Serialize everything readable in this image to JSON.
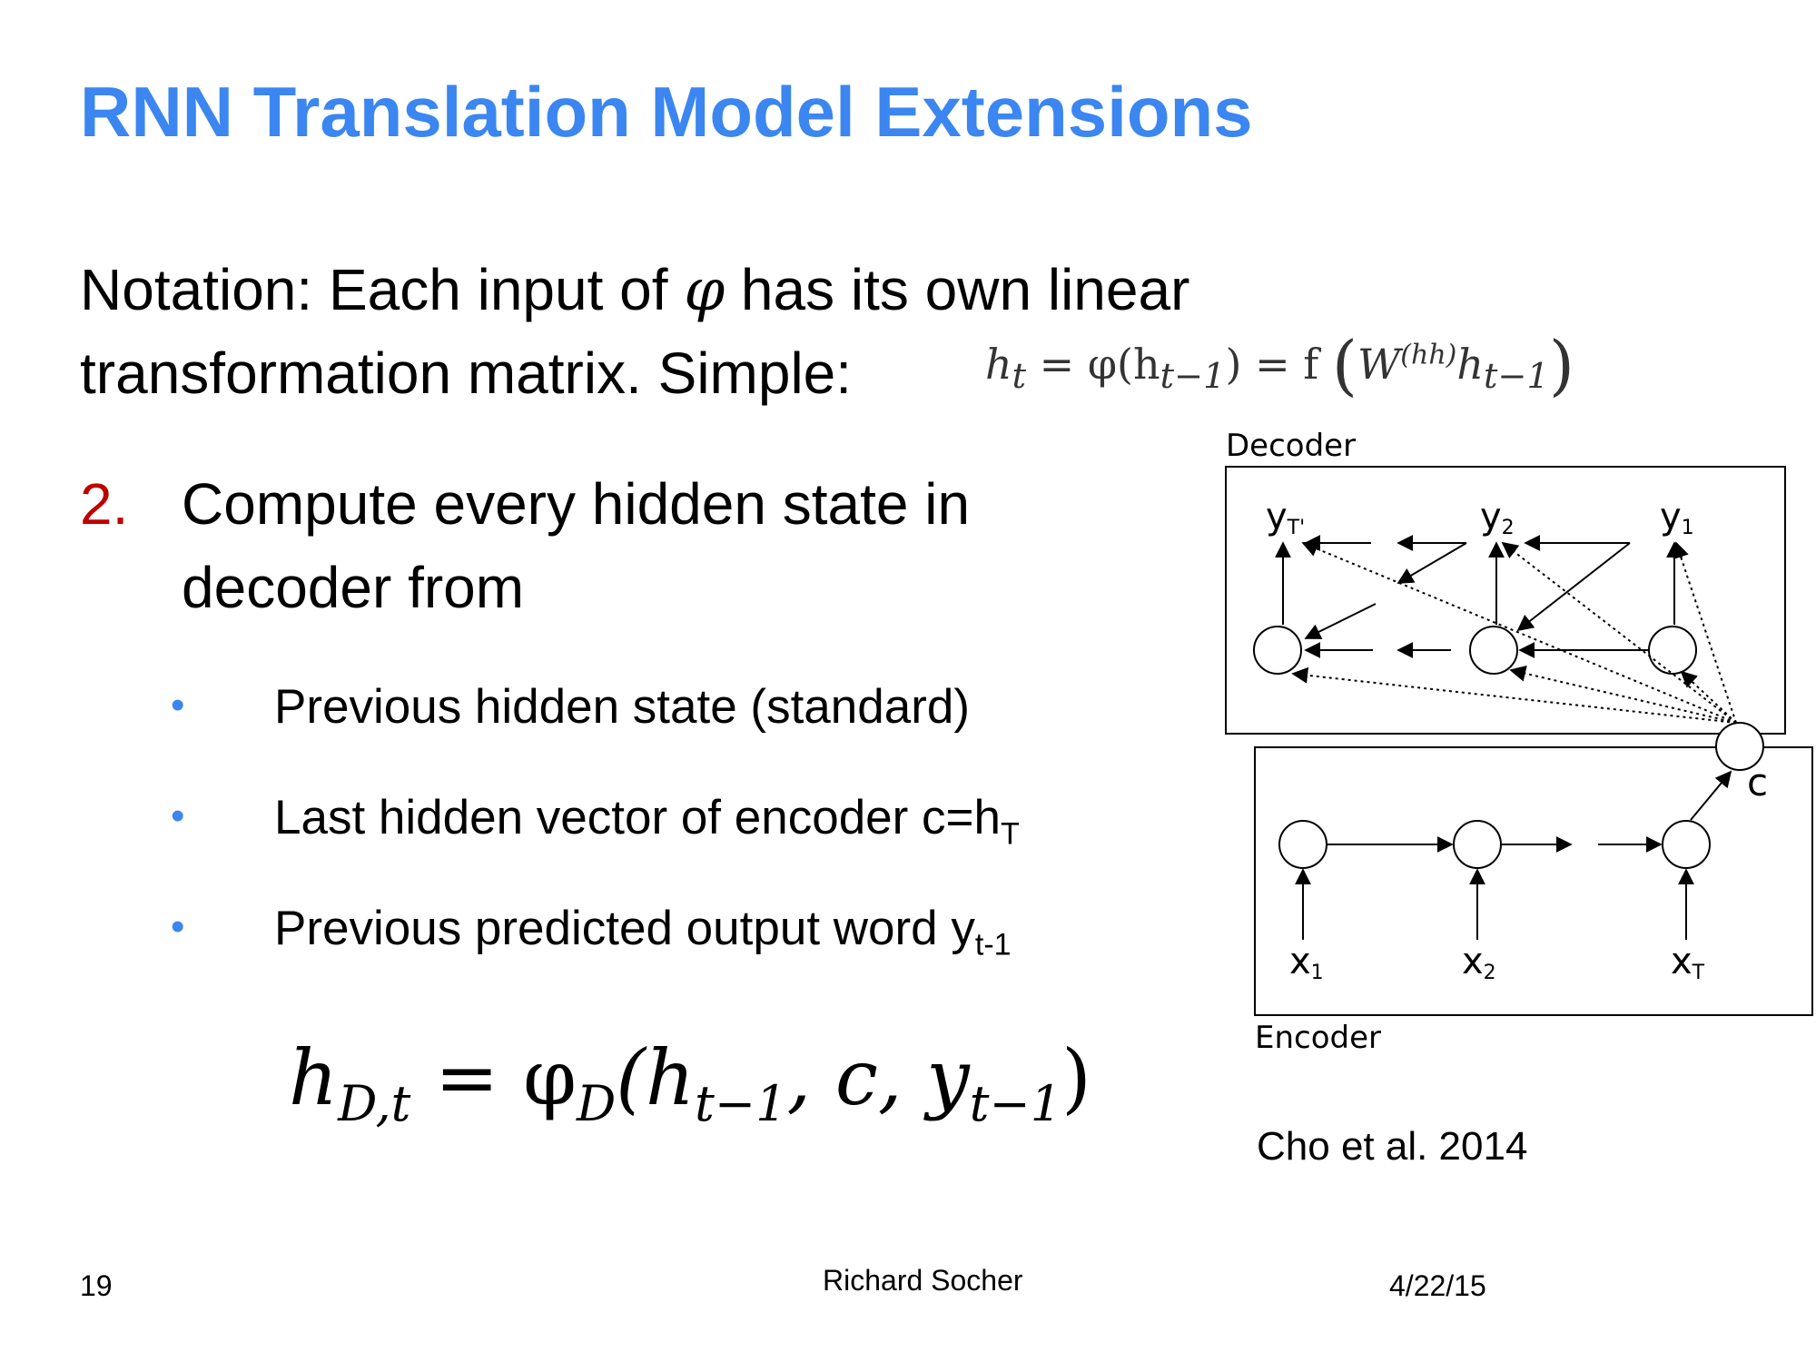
{
  "slide": {
    "title": "RNN Translation Model Extensions",
    "notation_line1_pre": "Notation: Each input of ",
    "phi_symbol": "φ",
    "notation_line1_post": " has its own linear",
    "notation_line2": "transformation matrix. Simple: ",
    "simple_eq": {
      "lhs": "h",
      "lhs_sub": "t",
      "eq1": " = φ(h",
      "arg_sub": "t−1",
      "eq2": ") = f ",
      "lparen": "(",
      "w": "W",
      "w_sup": "(hh)",
      "h": "h",
      "h_sub": "t−1",
      "rparen": ")"
    },
    "point_number": "2.",
    "point_line1": "Compute every hidden state in",
    "point_line2": "decoder from",
    "bullets": [
      {
        "marker": "•",
        "text": "Previous hidden state (standard)",
        "sub": ""
      },
      {
        "marker": "•",
        "text": "Last hidden vector of encoder c=h",
        "sub": "T"
      },
      {
        "marker": "•",
        "text": "Previous predicted output word y",
        "sub": "t-1"
      }
    ],
    "big_eq": {
      "h": "h",
      "h_sub": "D,t",
      "eq": " = φ",
      "phi_sub": "D",
      "open": "(h",
      "arg1_sub": "t−1",
      "mid": ", c, y",
      "arg3_sub": "t−1",
      "close": ")"
    },
    "diagram": {
      "decoder_label": "Decoder",
      "encoder_label": "Encoder",
      "outputs": [
        {
          "base": "y",
          "sub": "T'"
        },
        {
          "base": "y",
          "sub": "2"
        },
        {
          "base": "y",
          "sub": "1"
        }
      ],
      "inputs": [
        {
          "base": "x",
          "sub": "1"
        },
        {
          "base": "x",
          "sub": "2"
        },
        {
          "base": "x",
          "sub": "T"
        }
      ],
      "context_label": "c"
    },
    "citation": "Cho et al. 2014",
    "footer": {
      "page_number": "19",
      "author": "Richard Socher",
      "date": "4/22/15"
    }
  }
}
